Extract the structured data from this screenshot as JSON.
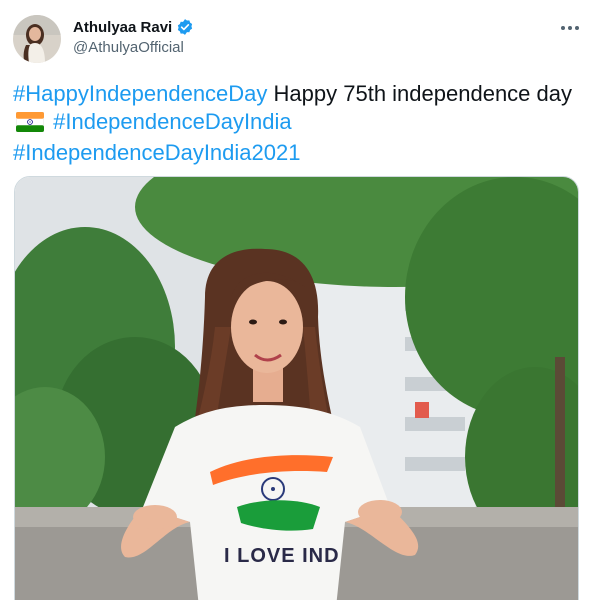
{
  "tweet": {
    "author": {
      "display_name": "Athulyaa Ravi",
      "handle": "@AthulyaOfficial",
      "verified": true,
      "verified_icon": "verified-badge-icon",
      "avatar": "avatar"
    },
    "more_icon": "more-horizontal-icon",
    "text": {
      "hashtag_1": "#HappyIndependenceDay",
      "body": " Happy 75th independence day ",
      "flag_emoji": "india-flag-emoji",
      "hashtag_2": "#IndependenceDayIndia",
      "hashtag_3": "#IndependenceDayIndia2021"
    },
    "media": {
      "shirt_text": "I LOVE IND"
    }
  },
  "colors": {
    "accent": "#1d9bf0",
    "text_primary": "#0f1419",
    "text_secondary": "#536471",
    "saffron": "#ff6f2b",
    "green": "#1a9d3a"
  }
}
